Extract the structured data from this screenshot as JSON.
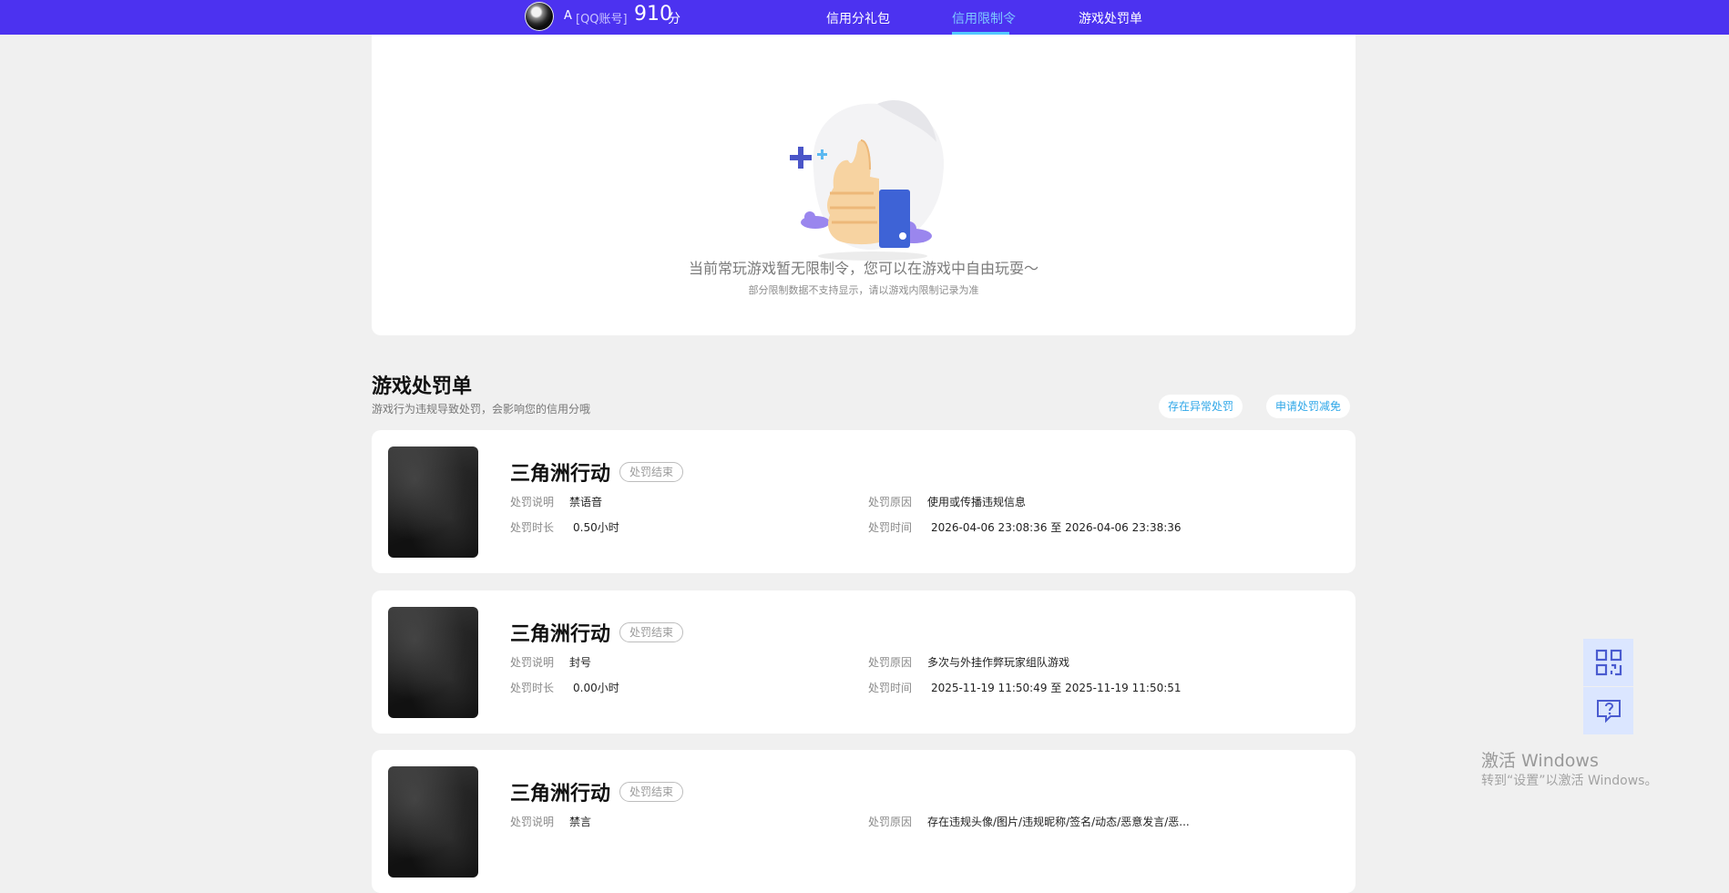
{
  "header": {
    "username": "A",
    "account_label": "[QQ账号]",
    "credit_score": "910",
    "score_unit": "分",
    "tabs": [
      {
        "label": "信用分礼包",
        "active": false
      },
      {
        "label": "信用限制令",
        "active": true
      },
      {
        "label": "游戏处罚单",
        "active": false
      }
    ],
    "colors": {
      "bar": "#4c32f0",
      "active_tab": "#7ec8ff"
    }
  },
  "restriction_panel": {
    "message": "当前常玩游戏暂无限制令，您可以在游戏中自由玩耍～",
    "note": "部分限制数据不支持显示，请以游戏内限制记录为准"
  },
  "penalties": {
    "title": "游戏处罚单",
    "subtitle": "游戏行为违规导致处罚，会影响您的信用分哦",
    "buttons": {
      "appeal_abnormal": "存在异常处罚",
      "apply_reduction": "申请处罚减免"
    },
    "field_labels": {
      "description": "处罚说明",
      "duration": "处罚时长",
      "reason": "处罚原因",
      "time": "处罚时间"
    },
    "items": [
      {
        "game": "三角洲行动",
        "status": "处罚结束",
        "description": "禁语音",
        "duration": "0.50小时",
        "reason": "使用或传播违规信息",
        "time": "2026-04-06 23:08:36 至 2026-04-06 23:38:36"
      },
      {
        "game": "三角洲行动",
        "status": "处罚结束",
        "description": "封号",
        "duration": "0.00小时",
        "reason": "多次与外挂作弊玩家组队游戏",
        "time": "2025-11-19 11:50:49 至 2025-11-19 11:50:51"
      },
      {
        "game": "三角洲行动",
        "status": "处罚结束",
        "description": "禁言",
        "reason": "存在违规头像/图片/违规昵称/签名/动态/恶意发言/恶..."
      }
    ]
  },
  "floating": {
    "icons": [
      "qr-code-icon",
      "help-chat-icon"
    ]
  },
  "os_watermark": {
    "line1": "激活 Windows",
    "line2": "转到“设置”以激活 Windows。"
  }
}
